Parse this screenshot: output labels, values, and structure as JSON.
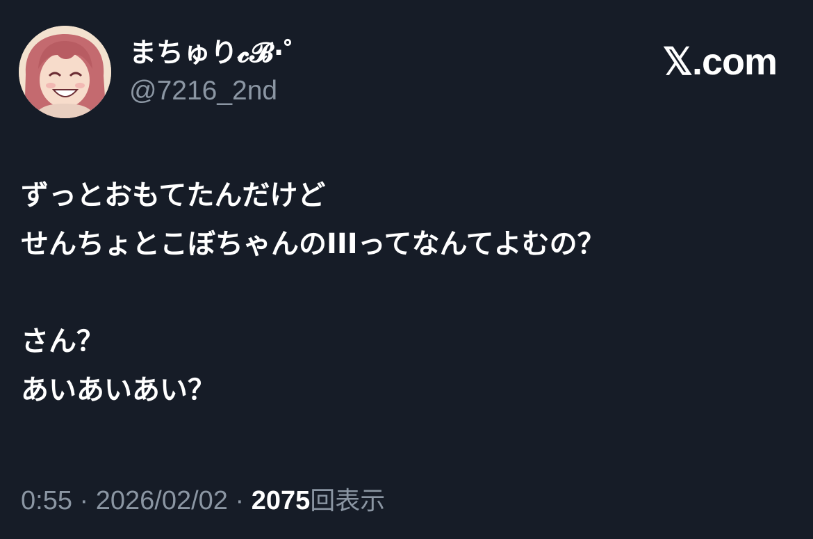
{
  "author": {
    "display_name": "まちゅり𝓬𝓑·゜",
    "handle": "@7216_2nd",
    "avatar_icon": "anime-avatar-icon"
  },
  "brand": {
    "label": "𝕏.com"
  },
  "tweet": {
    "lines": [
      "ずっとおもてたんだけど",
      "せんちょとこぼちゃんのIIIってなんてよむの？",
      "",
      "さん？",
      "あいあいあい？"
    ]
  },
  "meta": {
    "time": "0:55",
    "separator": " · ",
    "date": "2026/02/02",
    "views_count": "2075",
    "views_label": "回表示"
  },
  "colors": {
    "background": "#161c27",
    "text": "#ffffff",
    "muted": "#8b96a3"
  }
}
